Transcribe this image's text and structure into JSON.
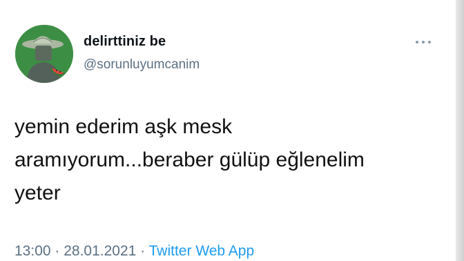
{
  "tweet": {
    "display_name": "delirttiniz be",
    "handle": "@sorunluyumcanim",
    "text_lines": [
      "yemin ederim aşk mesk",
      "aramıyorum...beraber gülüp eğlenelim",
      "yeter"
    ],
    "time": "13:00",
    "separator_1": " · ",
    "date": "28.01.2021",
    "separator_2": " · ",
    "source": "Twitter Web App"
  },
  "icons": {
    "avatar": "cartoon-avatar-with-hat-and-watermelon",
    "more": "more-options-icon"
  },
  "colors": {
    "text": "#0f1419",
    "secondary": "#5b7083",
    "link": "#1d9bf0",
    "avatar_bg": "#3d8e45"
  }
}
